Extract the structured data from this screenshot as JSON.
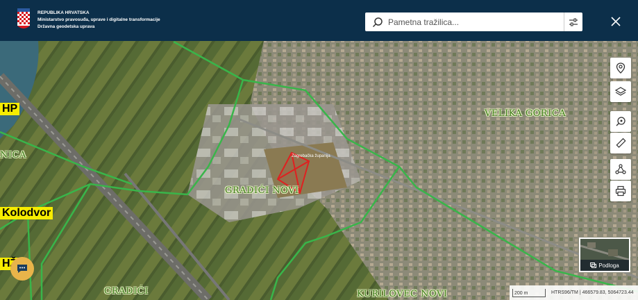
{
  "header": {
    "org_line1": "REPUBLIKA HRVATSKA",
    "org_line2": "Ministarstvo pravosuđa, uprave i digitalne transformacije",
    "org_line3": "Državna geodetska uprava"
  },
  "search": {
    "placeholder": "Pametna tražilica..."
  },
  "map": {
    "labels": {
      "hp": "HP",
      "hz": "HŽ",
      "kolodvor": "Kolodvor"
    },
    "places": {
      "velika_gorica": "VELIKA GORICA",
      "gradici_novi": "GRADIĆI NOVI",
      "gradici": "GRADIĆI",
      "kurilovec_novi": "KURILOVEC NOVI",
      "nica": "NICA"
    },
    "parcel_label": "Zagrebačka županija",
    "colors": {
      "boundary": "#39b54a",
      "parcel": "#e02020",
      "highlight": "#f6ec00"
    }
  },
  "toolbar": {
    "icons": [
      "location-pin-icon",
      "layers-icon",
      "zoom-search-icon",
      "ruler-icon",
      "share-icon",
      "print-icon"
    ]
  },
  "basemap": {
    "label": "Podloga"
  },
  "scale": {
    "bar_label": "200 m",
    "coords": "HTRS96/TM | 466579.83, 5064723.44"
  }
}
